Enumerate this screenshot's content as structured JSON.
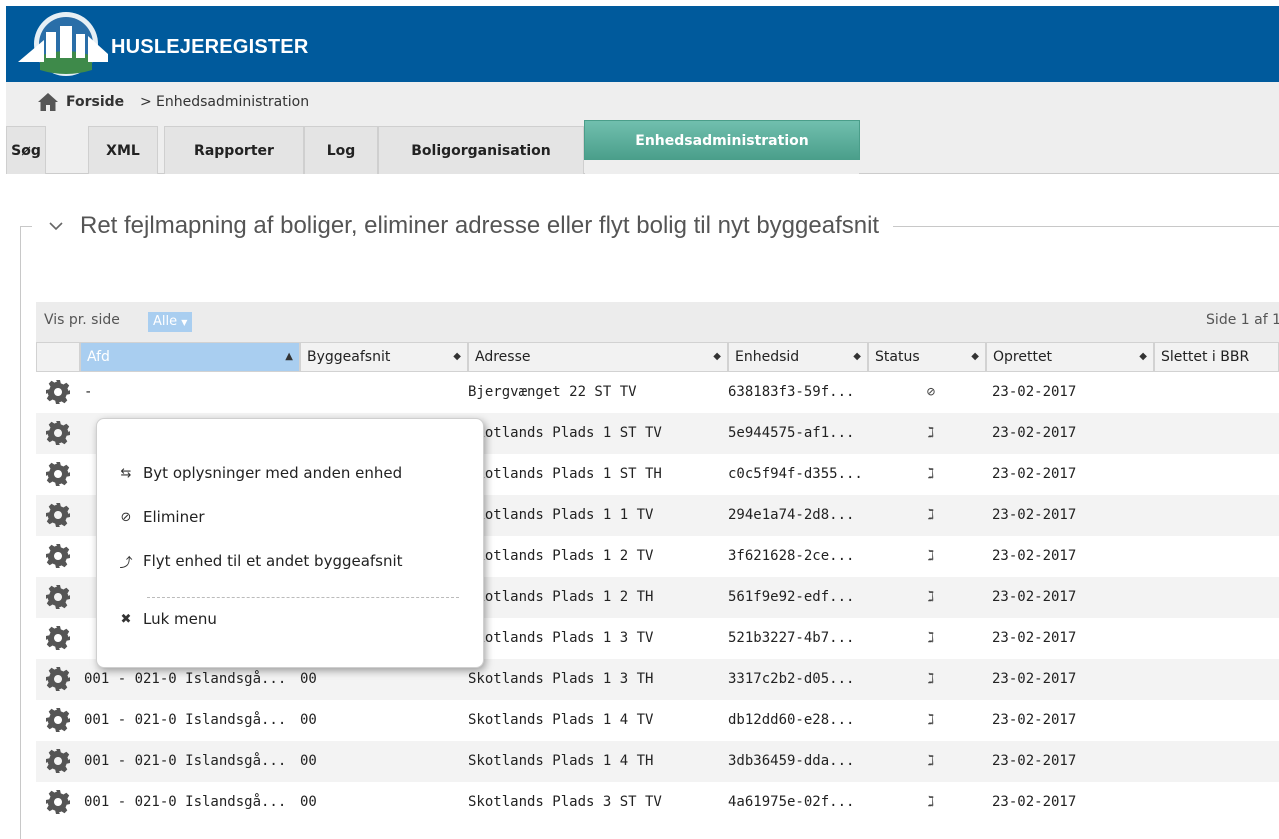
{
  "app": {
    "title": "HUSLEJEREGISTER"
  },
  "breadcrumb": {
    "home": "Forside",
    "separator": ">",
    "current": "Enhedsadministration"
  },
  "tabs": [
    {
      "label": "Søg"
    },
    {
      "label": "XML"
    },
    {
      "label": "Rapporter"
    },
    {
      "label": "Log"
    },
    {
      "label": "Boligorganisation"
    },
    {
      "label": "Enhedsadministration",
      "active": true
    }
  ],
  "section": {
    "title": "Ret fejlmapning af boliger, eliminer adresse eller flyt bolig til nyt byggeafsnit"
  },
  "table": {
    "per_page_label": "Vis pr. side",
    "per_page_value": "Alle",
    "page_info": "Side 1 af 1",
    "columns": [
      "Afd",
      "Byggeafsnit",
      "Adresse",
      "Enhedsid",
      "Status",
      "Oprettet",
      "Slettet i BBR"
    ],
    "sorted_column": "Afd",
    "rows": [
      {
        "afd": "-",
        "byggeafsnit": "",
        "adresse": "Bjergvænget 22 ST TV",
        "enhedsid": "638183f3-59f...",
        "status": "eliminated",
        "status_glyph": "⊘",
        "oprettet": "23-02-2017"
      },
      {
        "afd": "",
        "byggeafsnit": "",
        "adresse": "Skotlands Plads 1 ST TV",
        "enhedsid": "5e944575-af1...",
        "status": "feed",
        "status_glyph": "ℷ",
        "oprettet": "23-02-2017"
      },
      {
        "afd": "",
        "byggeafsnit": "",
        "adresse": "Skotlands Plads 1 ST TH",
        "enhedsid": "c0c5f94f-d355...",
        "status": "feed",
        "status_glyph": "ℷ",
        "oprettet": "23-02-2017"
      },
      {
        "afd": "",
        "byggeafsnit": "",
        "adresse": "Skotlands Plads 1 1 TV",
        "enhedsid": "294e1a74-2d8...",
        "status": "feed",
        "status_glyph": "ℷ",
        "oprettet": "23-02-2017"
      },
      {
        "afd": "",
        "byggeafsnit": "",
        "adresse": "Skotlands Plads 1 2 TV",
        "enhedsid": "3f621628-2ce...",
        "status": "feed",
        "status_glyph": "ℷ",
        "oprettet": "23-02-2017"
      },
      {
        "afd": "",
        "byggeafsnit": "",
        "adresse": "Skotlands Plads 1 2 TH",
        "enhedsid": "561f9e92-edf...",
        "status": "feed",
        "status_glyph": "ℷ",
        "oprettet": "23-02-2017"
      },
      {
        "afd": "",
        "byggeafsnit": "",
        "adresse": "Skotlands Plads 1 3 TV",
        "enhedsid": "521b3227-4b7...",
        "status": "feed",
        "status_glyph": "ℷ",
        "oprettet": "23-02-2017"
      },
      {
        "afd": "001 - 021-0 Islandsgå...",
        "byggeafsnit": "00",
        "adresse": "Skotlands Plads 1 3 TH",
        "enhedsid": "3317c2b2-d05...",
        "status": "feed",
        "status_glyph": "ℷ",
        "oprettet": "23-02-2017"
      },
      {
        "afd": "001 - 021-0 Islandsgå...",
        "byggeafsnit": "00",
        "adresse": "Skotlands Plads 1 4 TV",
        "enhedsid": "db12dd60-e28...",
        "status": "feed",
        "status_glyph": "ℷ",
        "oprettet": "23-02-2017"
      },
      {
        "afd": "001 - 021-0 Islandsgå...",
        "byggeafsnit": "00",
        "adresse": "Skotlands Plads 1 4 TH",
        "enhedsid": "3db36459-dda...",
        "status": "feed",
        "status_glyph": "ℷ",
        "oprettet": "23-02-2017"
      },
      {
        "afd": "001 - 021-0 Islandsgå...",
        "byggeafsnit": "00",
        "adresse": "Skotlands Plads 3 ST TV",
        "enhedsid": "4a61975e-02f...",
        "status": "feed",
        "status_glyph": "ℷ",
        "oprettet": "23-02-2017"
      }
    ]
  },
  "context_menu": {
    "items": [
      {
        "label": "Byt oplysninger med anden enhed",
        "icon": "swap-icon",
        "glyph": "⇆"
      },
      {
        "label": "Eliminer",
        "icon": "ban-icon",
        "glyph": "⊘"
      },
      {
        "label": "Flyt enhed til et andet byggeafsnit",
        "icon": "move-up-icon",
        "glyph": "⤴"
      },
      {
        "label": "Luk menu",
        "icon": "close-icon",
        "glyph": "✖"
      }
    ]
  },
  "colors": {
    "header": "#005a9c",
    "active_tab": "#5aae9a",
    "sorted_header": "#a9cef0"
  }
}
